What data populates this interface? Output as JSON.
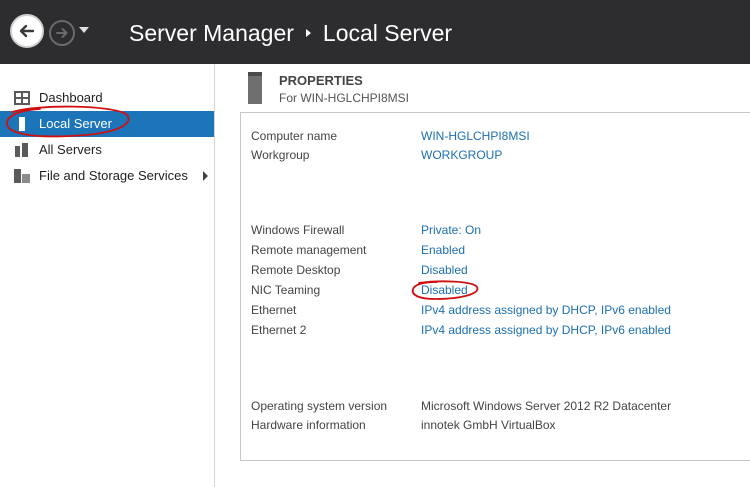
{
  "header": {
    "app_title": "Server Manager",
    "page_title": "Local Server"
  },
  "sidebar": {
    "items": [
      {
        "label": "Dashboard",
        "icon": "dashboard-icon"
      },
      {
        "label": "Local Server",
        "icon": "local-server-icon",
        "selected": true
      },
      {
        "label": "All Servers",
        "icon": "all-servers-icon"
      },
      {
        "label": "File and Storage Services",
        "icon": "file-storage-icon",
        "has_submenu": true
      }
    ]
  },
  "properties": {
    "heading": "PROPERTIES",
    "subheading": "For WIN-HGLCHPI8MSI",
    "rows": [
      {
        "key": "Computer name",
        "value": "WIN-HGLCHPI8MSI"
      },
      {
        "key": "Workgroup",
        "value": "WORKGROUP"
      },
      {
        "key": "Windows Firewall",
        "value": "Private: On"
      },
      {
        "key": "Remote management",
        "value": "Enabled"
      },
      {
        "key": "Remote Desktop",
        "value": "Disabled"
      },
      {
        "key": "NIC Teaming",
        "value": "Disabled"
      },
      {
        "key": "Ethernet",
        "value": "IPv4 address assigned by DHCP, IPv6 enabled"
      },
      {
        "key": "Ethernet 2",
        "value": "IPv4 address assigned by DHCP, IPv6 enabled"
      },
      {
        "key": "Operating system version",
        "value": "Microsoft Windows Server 2012 R2 Datacenter"
      },
      {
        "key": "Hardware information",
        "value": "innotek GmbH VirtualBox"
      }
    ]
  },
  "colors": {
    "header_bg": "#2d2d30",
    "selected_bg": "#1c74b9",
    "link": "#1c6fb3",
    "annotation": "#d01010"
  }
}
